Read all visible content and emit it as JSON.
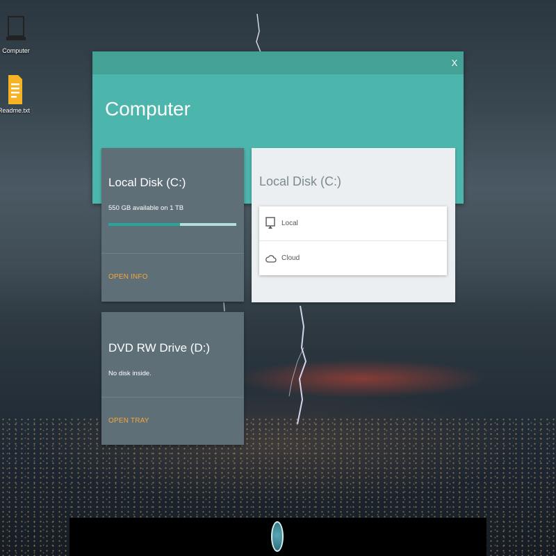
{
  "desktop": {
    "icons": [
      {
        "label": "Computer",
        "icon": "laptop-icon"
      },
      {
        "label": "Readme.txt",
        "icon": "document-icon",
        "color": "#f5b325"
      }
    ]
  },
  "window": {
    "title": "Computer",
    "close_label": "X",
    "header_color": "#4db6ac",
    "titlebar_color": "#43a295"
  },
  "drives": [
    {
      "name": "Local Disk (C:)",
      "status": "550 GB available on 1 TB",
      "usage_fraction": 0.55,
      "actions": [
        "OPEN",
        "INFO"
      ]
    },
    {
      "name": "DVD RW Drive (D:)",
      "status": "No disk inside.",
      "actions": [
        "OPEN TRAY"
      ]
    }
  ],
  "detail": {
    "title": "Local Disk (C:)",
    "items": [
      {
        "label": "Local",
        "icon": "monitor-icon"
      },
      {
        "label": "Cloud",
        "icon": "cloud-icon"
      }
    ]
  },
  "colors": {
    "accent": "#f3a83b",
    "progress_fill": "#26a69a",
    "progress_track": "#b2dfdb",
    "card_bg": "#5e6f78"
  },
  "taskbar": {
    "start_icon": "start-orb-icon"
  }
}
